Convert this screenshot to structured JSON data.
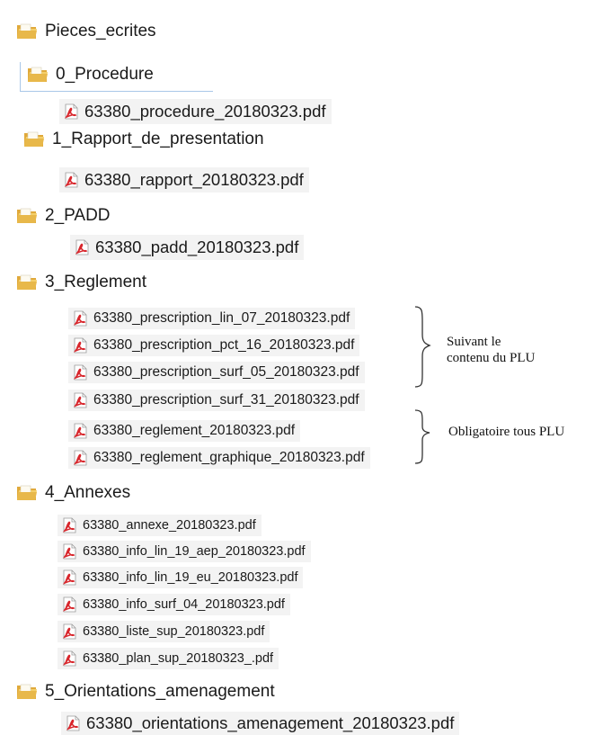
{
  "tree": {
    "root": {
      "label": "Pieces_ecrites",
      "icon": "folder-icon"
    },
    "folders": [
      {
        "label": "0_Procedure",
        "icon": "folder-icon",
        "files": [
          "63380_procedure_20180323.pdf"
        ]
      },
      {
        "label": "1_Rapport_de_presentation",
        "icon": "folder-icon",
        "files": [
          "63380_rapport_20180323.pdf"
        ]
      },
      {
        "label": "2_PADD",
        "icon": "folder-icon",
        "files": [
          "63380_padd_20180323.pdf"
        ]
      },
      {
        "label": "3_Reglement",
        "icon": "folder-icon",
        "files": [
          "63380_prescription_lin_07_20180323.pdf",
          "63380_prescription_pct_16_20180323.pdf",
          "63380_prescription_surf_05_20180323.pdf",
          "63380_prescription_surf_31_20180323.pdf",
          "63380_reglement_20180323.pdf",
          "63380_reglement_graphique_20180323.pdf"
        ]
      },
      {
        "label": "4_Annexes",
        "icon": "folder-icon",
        "files": [
          "63380_annexe_20180323.pdf",
          "63380_info_lin_19_aep_20180323.pdf",
          "63380_info_lin_19_eu_20180323.pdf",
          "63380_info_surf_04_20180323.pdf",
          "63380_liste_sup_20180323.pdf",
          "63380_plan_sup_20180323_.pdf"
        ]
      },
      {
        "label": "5_Orientations_amenagement",
        "icon": "folder-icon",
        "files": [
          "63380_orientations_amenagement_20180323.pdf"
        ]
      }
    ]
  },
  "annotations": {
    "optional": "Suivant le contenu du PLU",
    "optional_line1": "Suivant le",
    "optional_line2": "contenu du PLU",
    "mandatory": "Obligatoire tous PLU"
  },
  "colors": {
    "folder": "#e8b84a",
    "pdf": "#d8262c",
    "selection_border": "#a9c7e8",
    "file_bg": "#f3f3f3"
  }
}
